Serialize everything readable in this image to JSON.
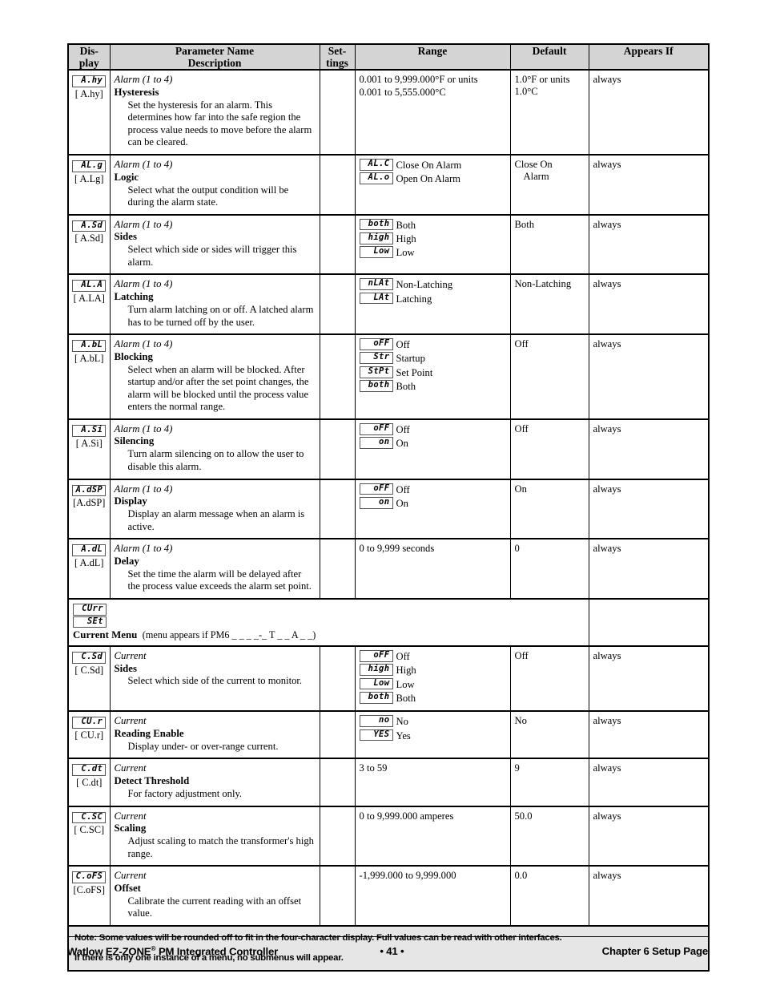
{
  "table": {
    "headers": {
      "display": "Dis-\nplay",
      "display_l1": "Dis-",
      "display_l2": "play",
      "param_l1": "Parameter Name",
      "param_l2": "Description",
      "settings_l1": "Set-",
      "settings_l2": "tings",
      "range": "Range",
      "default": "Default",
      "appears_if": "Appears If"
    },
    "rows": [
      {
        "seg": "A.hy",
        "code": "[ A.hy]",
        "group": "Alarm (1 to 4)",
        "name": "Hysteresis",
        "desc": "Set the hysteresis for an alarm. This determines how far into the safe region the process value needs to move before the alarm can be cleared.",
        "settings": "",
        "range_lines": [
          "0.001 to 9,999.000°F or units",
          "0.001 to 5,555.000°C"
        ],
        "range_options": [],
        "default_lines": [
          "1.0°F or units",
          "1.0°C"
        ],
        "appears": "always"
      },
      {
        "seg": "AL.g",
        "code": "[ A.Lg]",
        "group": "Alarm (1 to 4)",
        "name": "Logic",
        "desc": "Select what the output condition will be during the alarm state.",
        "settings": "",
        "range_lines": [],
        "range_options": [
          {
            "seg": "AL.C",
            "label": "Close On Alarm"
          },
          {
            "seg": "AL.o",
            "label": "Open On Alarm"
          }
        ],
        "default_lines": [
          "Close On",
          "Alarm"
        ],
        "default_indent_index": 1,
        "appears": "always"
      },
      {
        "seg": "A.Sd",
        "code": "[ A.Sd]",
        "group": "Alarm (1 to 4)",
        "name": "Sides",
        "desc": "Select which side or sides will trigger this alarm.",
        "settings": "",
        "range_lines": [],
        "range_options": [
          {
            "seg": "both",
            "label": "Both"
          },
          {
            "seg": "high",
            "label": "High"
          },
          {
            "seg": "Low",
            "label": "Low"
          }
        ],
        "default_lines": [
          "Both"
        ],
        "appears": "always"
      },
      {
        "seg": "AL.A",
        "code": "[ A.LA]",
        "group": "Alarm (1 to 4)",
        "name": "Latching",
        "desc": "Turn alarm latching on or off. A latched alarm has to be turned off by the user.",
        "settings": "",
        "range_lines": [],
        "range_options": [
          {
            "seg": "nLAt",
            "label": "Non-Latching"
          },
          {
            "seg": "LAt",
            "label": "Latching"
          }
        ],
        "default_lines": [
          "Non-Latching"
        ],
        "appears": "always"
      },
      {
        "seg": "A.bL",
        "code": "[ A.bL]",
        "group": "Alarm (1 to 4)",
        "name": "Blocking",
        "desc": "Select when an alarm will be blocked. After startup and/or after the set point changes, the alarm will be blocked until the process value enters the normal range.",
        "settings": "",
        "range_lines": [],
        "range_options": [
          {
            "seg": "oFF",
            "label": "Off"
          },
          {
            "seg": "Str",
            "label": "Startup"
          },
          {
            "seg": "StPt",
            "label": "Set Point"
          },
          {
            "seg": "both",
            "label": "Both"
          }
        ],
        "default_lines": [
          "Off"
        ],
        "appears": "always"
      },
      {
        "seg": "A.Si",
        "code": "[ A.Si]",
        "group": "Alarm (1 to 4)",
        "name": "Silencing",
        "desc": "Turn alarm silencing on to allow the user to disable this alarm.",
        "settings": "",
        "range_lines": [],
        "range_options": [
          {
            "seg": "oFF",
            "label": "Off"
          },
          {
            "seg": "on",
            "label": "On"
          }
        ],
        "default_lines": [
          "Off"
        ],
        "appears": "always"
      },
      {
        "seg": "A.dSP",
        "code": "[A.dSP]",
        "group": "Alarm (1 to 4)",
        "name": "Display",
        "desc": "Display an alarm message when an alarm is active.",
        "settings": "",
        "range_lines": [],
        "range_options": [
          {
            "seg": "oFF",
            "label": "Off"
          },
          {
            "seg": "on",
            "label": "On"
          }
        ],
        "default_lines": [
          "On"
        ],
        "appears": "always"
      },
      {
        "seg": "A.dL",
        "code": "[ A.dL]",
        "group": "Alarm (1 to 4)",
        "name": "Delay",
        "desc": "Set the time the alarm will be delayed after the process value exceeds the alarm set point.",
        "settings": "",
        "range_lines": [
          "0 to 9,999 seconds"
        ],
        "range_options": [],
        "default_lines": [
          "0"
        ],
        "appears": "always"
      }
    ],
    "menu_divider": {
      "seg_lines": [
        "CUrr",
        "SEt"
      ],
      "title": "Current Menu",
      "condition": "(menu appears if PM6 _ _ _ _-_ T _ _ A _ _)"
    },
    "rows2": [
      {
        "seg": "C.Sd",
        "code": "[ C.Sd]",
        "group": "Current",
        "name": "Sides",
        "desc": "Select which side of the current to monitor.",
        "settings": "",
        "range_lines": [],
        "range_options": [
          {
            "seg": "oFF",
            "label": "Off"
          },
          {
            "seg": "high",
            "label": "High"
          },
          {
            "seg": "Low",
            "label": "Low"
          },
          {
            "seg": "both",
            "label": "Both"
          }
        ],
        "default_lines": [
          "Off"
        ],
        "appears": "always"
      },
      {
        "seg": "CU.r",
        "code": "[ CU.r]",
        "group": "Current",
        "name": "Reading Enable",
        "desc": "Display under- or over-range current.",
        "settings": "",
        "range_lines": [],
        "range_options": [
          {
            "seg": "no",
            "label": "No"
          },
          {
            "seg": "YES",
            "label": "Yes"
          }
        ],
        "default_lines": [
          "No"
        ],
        "appears": "always"
      },
      {
        "seg": "C.dt",
        "code": "[ C.dt]",
        "group": "Current",
        "name": "Detect Threshold",
        "desc": "For factory adjustment only.",
        "settings": "",
        "range_lines": [
          "3 to 59"
        ],
        "range_options": [],
        "default_lines": [
          "9"
        ],
        "appears": "always"
      },
      {
        "seg": "C.SC",
        "code": "[ C.SC]",
        "group": "Current",
        "name": "Scaling",
        "desc": "Adjust scaling to match the transformer's high range.",
        "settings": "",
        "range_lines": [
          "0 to 9,999.000 amperes"
        ],
        "range_options": [],
        "default_lines": [
          "50.0"
        ],
        "appears": "always"
      },
      {
        "seg": "C.oFS",
        "code": "[C.oFS]",
        "group": "Current",
        "name": "Offset",
        "desc": "Calibrate the current reading with an offset value.",
        "settings": "",
        "range_lines": [
          "-1,999.000 to 9,999.000"
        ],
        "range_options": [],
        "default_lines": [
          "0.0"
        ],
        "appears": "always"
      }
    ],
    "note": {
      "line1": "Note: Some values will be rounded off to fit in the four-character display. Full values can be read with other interfaces.",
      "line2": "If there is only one instance of a menu, no submenus will appear."
    }
  },
  "footer": {
    "left_pre": "Watlow EZ-ZONE",
    "left_sup": "®",
    "left_post": " PM Integrated Controller",
    "center": "•  41  •",
    "right": "Chapter 6 Setup Page"
  }
}
